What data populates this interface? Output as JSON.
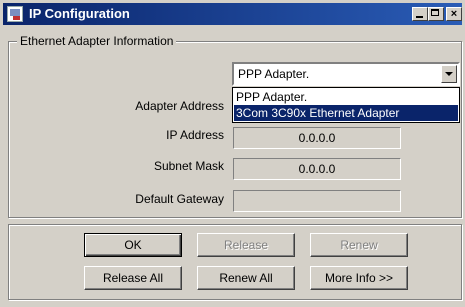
{
  "window": {
    "title": "IP Configuration"
  },
  "title_controls": {
    "minimize": "minimize-icon",
    "maximize": "maximize-icon",
    "close": "×"
  },
  "group": {
    "label": "Ethernet  Adapter Information"
  },
  "adapter_select": {
    "value": "PPP Adapter.",
    "options": [
      "PPP Adapter.",
      "3Com 3C90x Ethernet Adapter"
    ],
    "highlighted": 1
  },
  "fields": [
    {
      "label": "Adapter Address",
      "value": ""
    },
    {
      "label": "IP Address",
      "value": "0.0.0.0"
    },
    {
      "label": "Subnet Mask",
      "value": "0.0.0.0"
    },
    {
      "label": "Default Gateway",
      "value": ""
    }
  ],
  "buttons": {
    "ok": "OK",
    "release": "Release",
    "renew": "Renew",
    "release_all": "Release All",
    "renew_all": "Renew All",
    "more_info": "More Info >>"
  },
  "colors": {
    "title_bar": "#0a246a",
    "selection": "#0a246a",
    "face": "#d4d0c8"
  }
}
